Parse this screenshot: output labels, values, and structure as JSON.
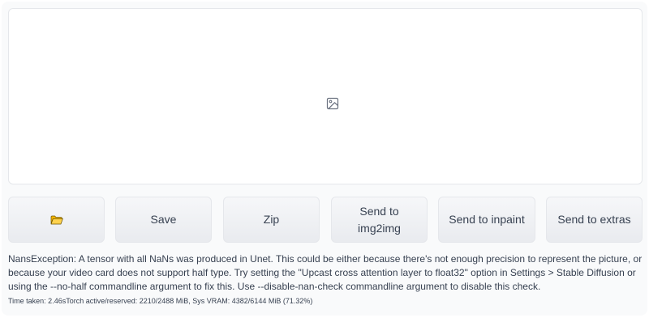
{
  "gallery": {
    "icon": "image-placeholder-icon"
  },
  "buttons": {
    "open_folder": {
      "icon": "folder-icon",
      "color": "#f4b400"
    },
    "save": "Save",
    "zip": "Zip",
    "send_img2img": "Send to img2img",
    "send_inpaint": "Send to inpaint",
    "send_extras": "Send to extras"
  },
  "output": {
    "error_text": "NansException: A tensor with all NaNs was produced in Unet. This could be either because there's not enough precision to represent the picture, or because your video card does not support half type. Try setting the \"Upcast cross attention layer to float32\" option in Settings > Stable Diffusion or using the --no-half commandline argument to fix this. Use --disable-nan-check commandline argument to disable this check.",
    "timing_text": "Time taken: 2.46sTorch active/reserved: 2210/2488 MiB, Sys VRAM: 4382/6144 MiB (71.32%)"
  },
  "colors": {
    "panel_bg": "#f9fafb",
    "button_bg": "#eceef2",
    "border": "#e5e7eb",
    "text": "#374151"
  }
}
